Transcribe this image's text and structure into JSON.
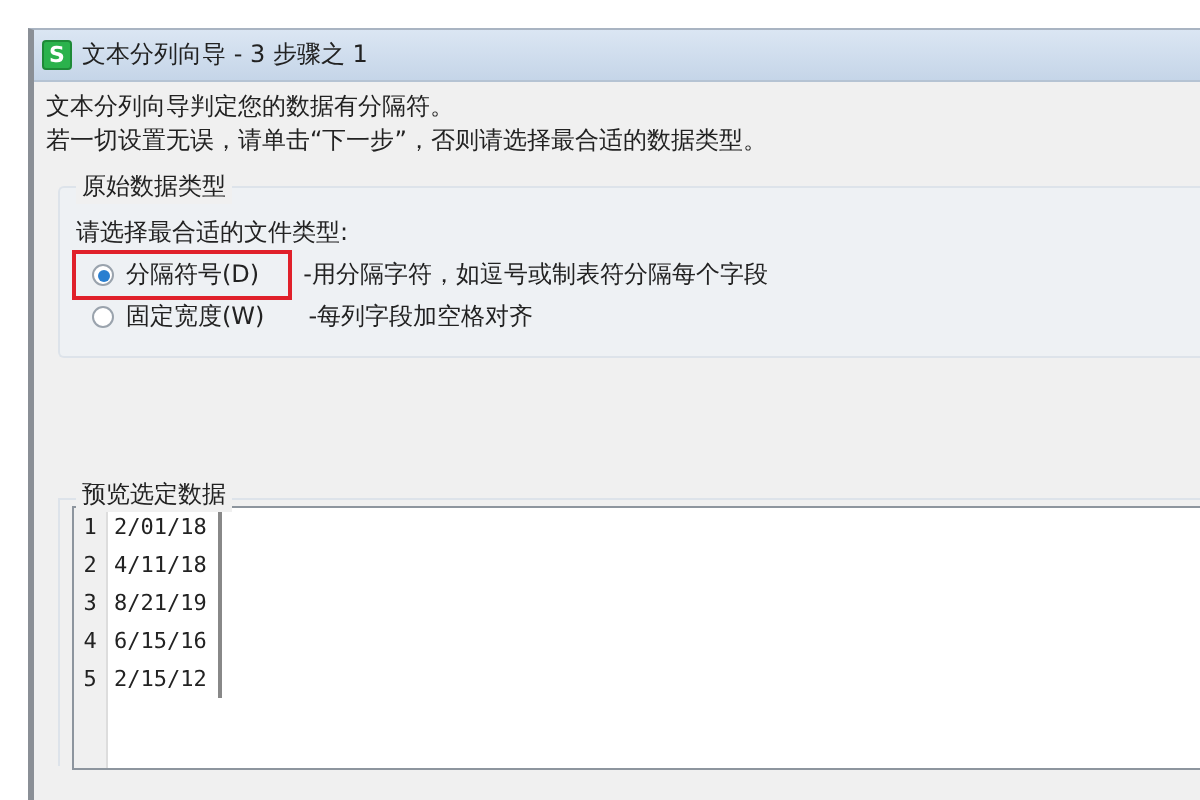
{
  "window": {
    "title": "文本分列向导 - 3 步骤之 1",
    "app_icon": "S"
  },
  "intro": [
    "文本分列向导判定您的数据有分隔符。",
    "若一切设置无误，请单击“下一步”，否则请选择最合适的数据类型。"
  ],
  "original_type": {
    "legend": "原始数据类型",
    "prompt": "请选择最合适的文件类型:",
    "options": [
      {
        "label": "分隔符号(D)",
        "description": "-用分隔字符，如逗号或制表符分隔每个字段",
        "selected": true,
        "highlighted": true
      },
      {
        "label": "固定宽度(W)",
        "description": "-每列字段加空格对齐",
        "selected": false,
        "highlighted": false
      }
    ]
  },
  "preview": {
    "legend": "预览选定数据",
    "rows": [
      {
        "number": "1",
        "value": "2/01/18"
      },
      {
        "number": "2",
        "value": "4/11/18"
      },
      {
        "number": "3",
        "value": "8/21/19"
      },
      {
        "number": "4",
        "value": "6/15/16"
      },
      {
        "number": "5",
        "value": "2/15/12"
      }
    ]
  }
}
